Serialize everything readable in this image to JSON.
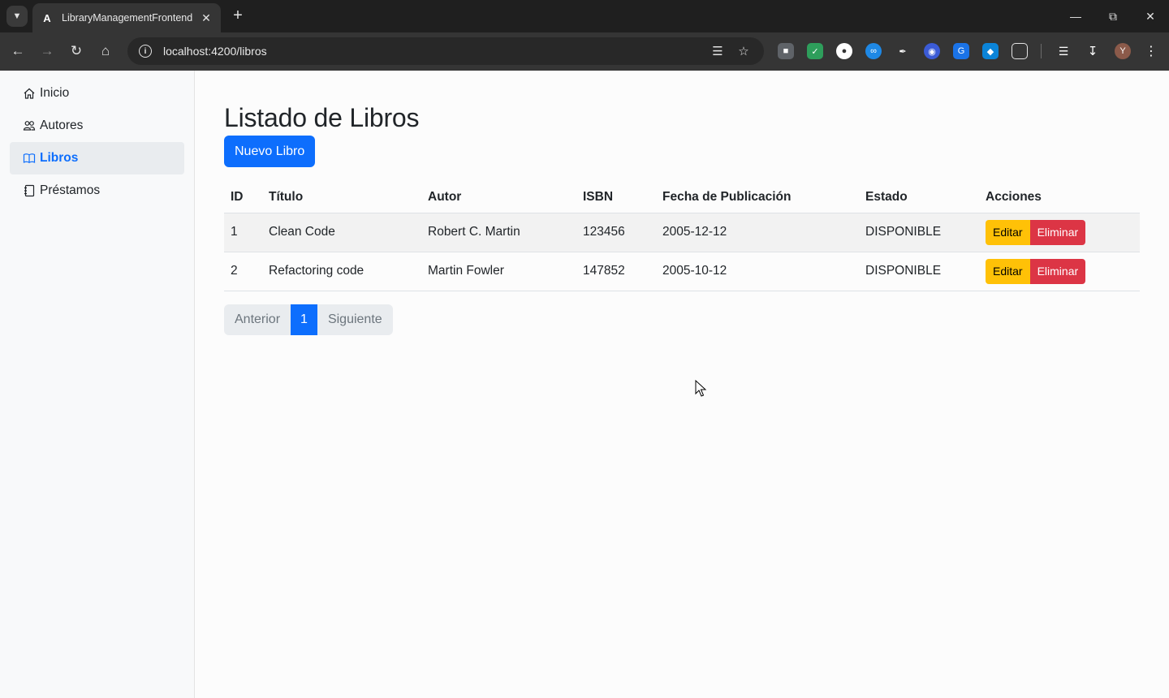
{
  "browser": {
    "tab_title": "LibraryManagementFrontend",
    "url": "localhost:4200/libros",
    "profile_initial": "Y"
  },
  "sidebar": {
    "items": [
      {
        "label": "Inicio",
        "icon": "house-icon",
        "active": false
      },
      {
        "label": "Autores",
        "icon": "people-icon",
        "active": false
      },
      {
        "label": "Libros",
        "icon": "book-icon",
        "active": true
      },
      {
        "label": "Préstamos",
        "icon": "journal-icon",
        "active": false
      }
    ]
  },
  "main": {
    "title": "Listado de Libros",
    "new_button": "Nuevo Libro",
    "table": {
      "headers": [
        "ID",
        "Título",
        "Autor",
        "ISBN",
        "Fecha de Publicación",
        "Estado",
        "Acciones"
      ],
      "rows": [
        {
          "id": "1",
          "titulo": "Clean Code",
          "autor": "Robert C. Martin",
          "isbn": "123456",
          "fecha": "2005-12-12",
          "estado": "DISPONIBLE"
        },
        {
          "id": "2",
          "titulo": "Refactoring code",
          "autor": "Martin Fowler",
          "isbn": "147852",
          "fecha": "2005-10-12",
          "estado": "DISPONIBLE"
        }
      ],
      "edit_label": "Editar",
      "delete_label": "Eliminar"
    },
    "pagination": {
      "prev": "Anterior",
      "current": "1",
      "next": "Siguiente"
    }
  },
  "colors": {
    "primary": "#0d6efd",
    "warning": "#ffc107",
    "danger": "#dc3545"
  }
}
